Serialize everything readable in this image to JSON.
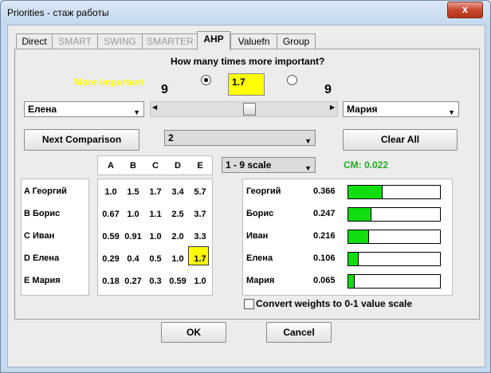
{
  "window": {
    "title": "Priorities - стаж работы",
    "close_glyph": "x"
  },
  "tabs": [
    {
      "label": "Direct",
      "enabled": true
    },
    {
      "label": "SMART",
      "enabled": false
    },
    {
      "label": "SWING",
      "enabled": false
    },
    {
      "label": "SMARTER",
      "enabled": false
    },
    {
      "label": "AHP",
      "enabled": true,
      "active": true
    },
    {
      "label": "Valuefn",
      "enabled": true
    },
    {
      "label": "Group",
      "enabled": true
    }
  ],
  "ahp": {
    "question": "How many times more important?",
    "more_important_label": "More important",
    "ratio_value": "1.7",
    "left_scale_label": "9",
    "right_scale_label": "9",
    "left_selected": true,
    "left_option": "Елена",
    "right_option": "Мария",
    "slider_position": 0.53,
    "next_button": "Next Comparison",
    "comparison_select": "2",
    "clear_button": "Clear All",
    "scale_select": "1 - 9 scale",
    "cm_label": "CM: 0.022"
  },
  "matrix": {
    "columns": [
      "A",
      "B",
      "C",
      "D",
      "E"
    ],
    "rows": [
      {
        "label": "A Георгий",
        "values": [
          "1.0",
          "1.5",
          "1.7",
          "3.4",
          "5.7"
        ]
      },
      {
        "label": "B Борис",
        "values": [
          "0.67",
          "1.0",
          "1.1",
          "2.5",
          "3.7"
        ]
      },
      {
        "label": "C Иван",
        "values": [
          "0.59",
          "0.91",
          "1.0",
          "2.0",
          "3.3"
        ]
      },
      {
        "label": "D Елена",
        "values": [
          "0.29",
          "0.4",
          "0.5",
          "1.0",
          "1.7"
        ]
      },
      {
        "label": "E Мария",
        "values": [
          "0.18",
          "0.27",
          "0.3",
          "0.59",
          "1.0"
        ]
      }
    ],
    "highlight_color": "#ffff00"
  },
  "weights": [
    {
      "name": "Георгий",
      "value": "0.366",
      "fraction": 0.366
    },
    {
      "name": "Борис",
      "value": "0.247",
      "fraction": 0.247
    },
    {
      "name": "Иван",
      "value": "0.216",
      "fraction": 0.216
    },
    {
      "name": "Елена",
      "value": "0.106",
      "fraction": 0.106
    },
    {
      "name": "Мария",
      "value": "0.065",
      "fraction": 0.065
    }
  ],
  "convert_label": "Convert weights to 0-1 value scale",
  "convert_checked": false,
  "ok_button": "OK",
  "cancel_button": "Cancel",
  "colors": {
    "bar_fill": "#11dd11",
    "cm_text": "#22aa22",
    "more_important": "#ffff00",
    "ratio_bg": "#ffff00"
  }
}
